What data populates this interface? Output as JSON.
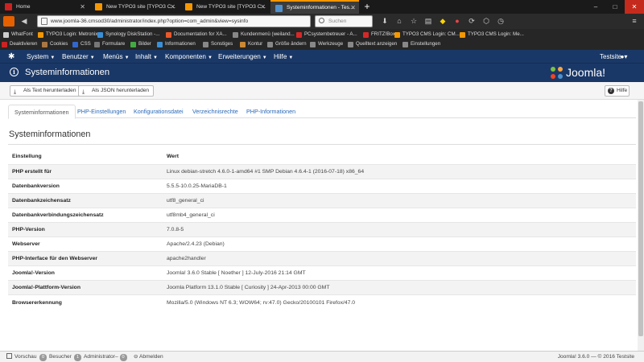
{
  "browser": {
    "tabs": [
      {
        "title": "Home",
        "color": "#cc2222"
      },
      {
        "title": "New TYPO3 site [TYPO3 C...",
        "color": "#f49700"
      },
      {
        "title": "New TYPO3 site [TYPO3 C...",
        "color": "#f49700"
      },
      {
        "title": "Systeminformationen - Tes...",
        "color": "#5091cd",
        "active": true
      }
    ],
    "new_tab_glyph": "+",
    "window_controls": [
      "–",
      "□",
      "✕"
    ],
    "url": "www.joomla-36.cmsod30/administrator/index.php?option=com_admin&view=sysinfo",
    "search_placeholder": "Suchen",
    "bookmarks_row1": [
      {
        "label": "WhatFont",
        "color": "#cccccc"
      },
      {
        "label": "TYPO3 Login: Metronix...",
        "color": "#f49700"
      },
      {
        "label": "Synology DiskStation -...",
        "color": "#3a8fd6"
      },
      {
        "label": "Documentation for XA...",
        "color": "#e8582a"
      },
      {
        "label": "Kundenmenü (weiland...",
        "color": "#888888"
      },
      {
        "label": "PCsystembetreuer - A...",
        "color": "#d62828"
      },
      {
        "label": "FRITZ!Box",
        "color": "#d62828"
      },
      {
        "label": "TYPO3 CMS Login: CM...",
        "color": "#f49700"
      },
      {
        "label": "TYPO3 CMS Login: Me...",
        "color": "#f49700"
      }
    ],
    "bookmarks_row2": [
      {
        "label": "Deaktivieren",
        "color": "#cc2222"
      },
      {
        "label": "Cookies",
        "color": "#aa7744"
      },
      {
        "label": "CSS",
        "color": "#3366cc"
      },
      {
        "label": "Formulare",
        "color": "#777777"
      },
      {
        "label": "Bilder",
        "color": "#44aa44"
      },
      {
        "label": "Informationen",
        "color": "#3a8fd6"
      },
      {
        "label": "Sonstiges",
        "color": "#888888"
      },
      {
        "label": "Kontur",
        "color": "#cc8833"
      },
      {
        "label": "Größe ändern",
        "color": "#888888"
      },
      {
        "label": "Werkzeuge",
        "color": "#888888"
      },
      {
        "label": "Quelltext anzeigen",
        "color": "#888888"
      },
      {
        "label": "Einstellungen",
        "color": "#888888"
      }
    ]
  },
  "joomla": {
    "menu": [
      "System",
      "Benutzer",
      "Menüs",
      "Inhalt",
      "Komponenten",
      "Erweiterungen",
      "Hilfe"
    ],
    "site_link": "Testsite",
    "user_menu": "▾",
    "page_title": "Systeminformationen",
    "brand": "Joomla!",
    "toolbar": {
      "download_text": "Als Text herunterladen",
      "download_json": "Als JSON herunterladen",
      "help": "Hilfe"
    },
    "tabs": [
      "Systeminformationen",
      "PHP-Einstellungen",
      "Konfigurationsdatei",
      "Verzeichnisrechte",
      "PHP-Informationen"
    ],
    "section_title": "Systeminformationen",
    "table_headers": [
      "Einstellung",
      "Wert"
    ],
    "rows": [
      [
        "PHP erstellt für",
        "Linux debian-stretch 4.6.0-1-amd64 #1 SMP Debian 4.6.4-1 (2016-07-18) x86_64"
      ],
      [
        "Datenbankversion",
        "5.5.5-10.0.25-MariaDB-1"
      ],
      [
        "Datenbankzeichensatz",
        "utf8_general_ci"
      ],
      [
        "Datenbankverbindungszeichensatz",
        "utf8mb4_general_ci"
      ],
      [
        "PHP-Version",
        "7.0.8-5"
      ],
      [
        "Webserver",
        "Apache/2.4.23 (Debian)"
      ],
      [
        "PHP-Interface für den Webserver",
        "apache2handler"
      ],
      [
        "Joomla!-Version",
        "Joomla! 3.6.0 Stable [ Noether ] 12-July-2016 21:14 GMT"
      ],
      [
        "Joomla!-Plattform-Version",
        "Joomla Platform 13.1.0 Stable [ Curiosity ] 24-Apr-2013 00:00 GMT"
      ],
      [
        "Browsererkennung",
        "Mozilla/5.0 (Windows NT 6.3; WOW64; rv:47.0) Gecko/20100101 Firefox/47.0"
      ]
    ],
    "status": {
      "preview": "Vorschau",
      "visitors_count": "0",
      "visitors": "Besucher",
      "admins_count": "1",
      "admins": "Administrator",
      "messages_count": "0",
      "logout": "Abmelden",
      "footer": "Joomla! 3.6.0 — © 2016 Testsite"
    }
  },
  "colors": {
    "joomla_header": "#1a3867",
    "link": "#2a69b8"
  }
}
